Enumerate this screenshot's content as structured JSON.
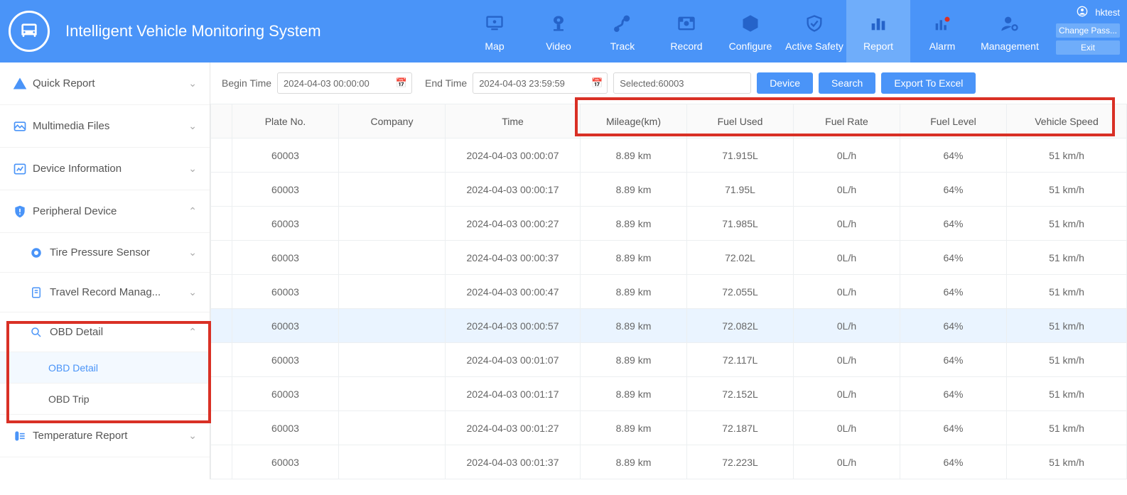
{
  "app": {
    "title": "Intelligent Vehicle Monitoring System"
  },
  "user": {
    "name": "hktest",
    "change_pass": "Change Pass...",
    "exit": "Exit"
  },
  "nav": {
    "map": "Map",
    "video": "Video",
    "track": "Track",
    "record": "Record",
    "configure": "Configure",
    "active_safety": "Active Safety",
    "report": "Report",
    "alarm": "Alarm",
    "management": "Management"
  },
  "sidebar": {
    "quick_report": "Quick Report",
    "multimedia": "Multimedia Files",
    "device_info": "Device Information",
    "peripheral": "Peripheral Device",
    "tire": "Tire Pressure Sensor",
    "travel_record": "Travel Record Manag...",
    "obd_detail_parent": "OBD Detail",
    "obd_detail": "OBD Detail",
    "obd_trip": "OBD Trip",
    "temperature": "Temperature Report"
  },
  "filter": {
    "begin_label": "Begin Time",
    "begin_value": "2024-04-03 00:00:00",
    "end_label": "End Time",
    "end_value": "2024-04-03 23:59:59",
    "selected": "Selected:60003",
    "device_btn": "Device",
    "search_btn": "Search",
    "export_btn": "Export To Excel"
  },
  "table": {
    "headers": {
      "blank": "",
      "plate": "Plate No.",
      "company": "Company",
      "time": "Time",
      "mileage": "Mileage(km)",
      "fuel_used": "Fuel Used",
      "fuel_rate": "Fuel Rate",
      "fuel_level": "Fuel Level",
      "speed": "Vehicle Speed"
    },
    "rows": [
      {
        "plate": "60003",
        "company": "",
        "time": "2024-04-03 00:00:07",
        "mileage": "8.89 km",
        "fuel_used": "71.915L",
        "fuel_rate": "0L/h",
        "fuel_level": "64%",
        "speed": "51 km/h"
      },
      {
        "plate": "60003",
        "company": "",
        "time": "2024-04-03 00:00:17",
        "mileage": "8.89 km",
        "fuel_used": "71.95L",
        "fuel_rate": "0L/h",
        "fuel_level": "64%",
        "speed": "51 km/h"
      },
      {
        "plate": "60003",
        "company": "",
        "time": "2024-04-03 00:00:27",
        "mileage": "8.89 km",
        "fuel_used": "71.985L",
        "fuel_rate": "0L/h",
        "fuel_level": "64%",
        "speed": "51 km/h"
      },
      {
        "plate": "60003",
        "company": "",
        "time": "2024-04-03 00:00:37",
        "mileage": "8.89 km",
        "fuel_used": "72.02L",
        "fuel_rate": "0L/h",
        "fuel_level": "64%",
        "speed": "51 km/h"
      },
      {
        "plate": "60003",
        "company": "",
        "time": "2024-04-03 00:00:47",
        "mileage": "8.89 km",
        "fuel_used": "72.055L",
        "fuel_rate": "0L/h",
        "fuel_level": "64%",
        "speed": "51 km/h"
      },
      {
        "plate": "60003",
        "company": "",
        "time": "2024-04-03 00:00:57",
        "mileage": "8.89 km",
        "fuel_used": "72.082L",
        "fuel_rate": "0L/h",
        "fuel_level": "64%",
        "speed": "51 km/h",
        "hover": true
      },
      {
        "plate": "60003",
        "company": "",
        "time": "2024-04-03 00:01:07",
        "mileage": "8.89 km",
        "fuel_used": "72.117L",
        "fuel_rate": "0L/h",
        "fuel_level": "64%",
        "speed": "51 km/h"
      },
      {
        "plate": "60003",
        "company": "",
        "time": "2024-04-03 00:01:17",
        "mileage": "8.89 km",
        "fuel_used": "72.152L",
        "fuel_rate": "0L/h",
        "fuel_level": "64%",
        "speed": "51 km/h"
      },
      {
        "plate": "60003",
        "company": "",
        "time": "2024-04-03 00:01:27",
        "mileage": "8.89 km",
        "fuel_used": "72.187L",
        "fuel_rate": "0L/h",
        "fuel_level": "64%",
        "speed": "51 km/h"
      },
      {
        "plate": "60003",
        "company": "",
        "time": "2024-04-03 00:01:37",
        "mileage": "8.89 km",
        "fuel_used": "72.223L",
        "fuel_rate": "0L/h",
        "fuel_level": "64%",
        "speed": "51 km/h"
      }
    ]
  }
}
